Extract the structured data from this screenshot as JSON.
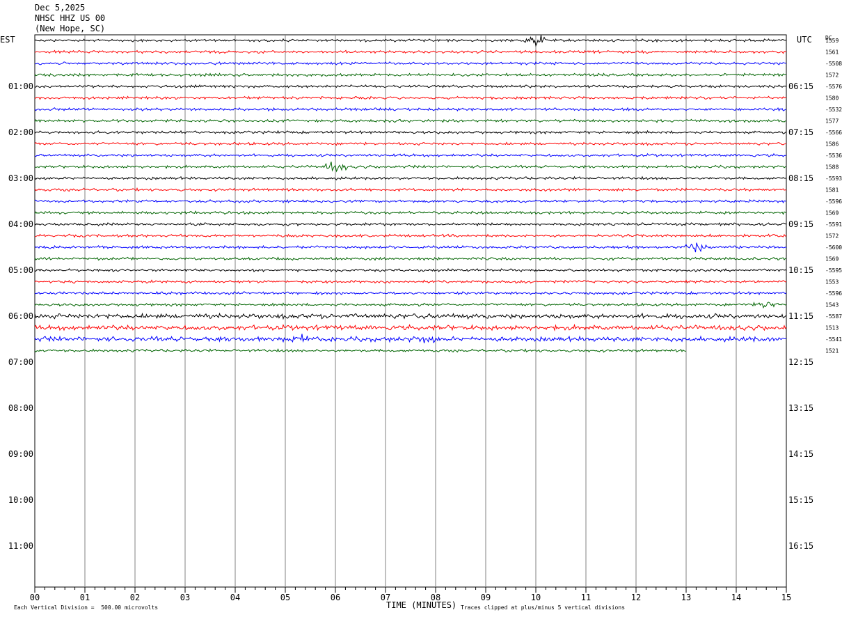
{
  "header": {
    "date": "Dec 5,2025",
    "station": "NHSC HHZ US 00",
    "location": "(New Hope, SC)"
  },
  "left_zone": "EST",
  "right_zone": "UTC",
  "dc_header": "DC",
  "x_axis_title": "TIME (MINUTES)",
  "footer_scale": "Each Vertical Division =  500.00 microvolts",
  "footer_clip": "Traces clipped at plus/minus 5 vertical divisions",
  "colors": {
    "cycle": [
      "#000000",
      "#ff0000",
      "#0000ff",
      "#006400"
    ],
    "grid": "#808080"
  },
  "chart_data": {
    "type": "line",
    "title": "NHSC HHZ US 00",
    "xlabel": "TIME (MINUTES)",
    "xlim": [
      0,
      15
    ],
    "x_ticks": [
      "00",
      "01",
      "02",
      "03",
      "04",
      "05",
      "06",
      "07",
      "08",
      "09",
      "10",
      "11",
      "12",
      "13",
      "14",
      "15"
    ],
    "rows_per_hour": 4,
    "hour_labels_left": [
      "01:00",
      "02:00",
      "03:00",
      "04:00",
      "05:00",
      "06:00",
      "07:00",
      "08:00",
      "09:00",
      "10:00",
      "11:00"
    ],
    "hour_labels_right": [
      "06:15",
      "07:15",
      "08:15",
      "09:15",
      "10:15",
      "11:15",
      "12:15",
      "13:15",
      "14:15",
      "15:15",
      "16:15"
    ],
    "dc_offsets": [
      "1559",
      "1561",
      "-5508",
      "1572",
      "-5576",
      "1580",
      "-5532",
      "1577",
      "-5566",
      "1586",
      "-5536",
      "1588",
      "-5593",
      "1581",
      "-5596",
      "1569",
      "-5591",
      "1572",
      "-5600",
      "1569",
      "-5595",
      "1553",
      "-5596",
      "1543",
      "-5587",
      "1513",
      "-5541",
      "1521"
    ],
    "trace_count": 28,
    "last_trace_end_minute": 13.0,
    "events": [
      {
        "row": 0,
        "minute": 10.0,
        "amplitude": 2.2
      },
      {
        "row": 11,
        "minute": 6.0,
        "amplitude": 1.6
      },
      {
        "row": 18,
        "minute": 13.2,
        "amplitude": 1.5
      },
      {
        "row": 23,
        "minute": 14.6,
        "amplitude": 1.3
      },
      {
        "row": 26,
        "minute": 5.3,
        "amplitude": 1.0
      },
      {
        "row": 26,
        "minute": 7.8,
        "amplitude": 0.8
      }
    ],
    "noisy_rows": [
      24,
      25,
      26
    ]
  }
}
